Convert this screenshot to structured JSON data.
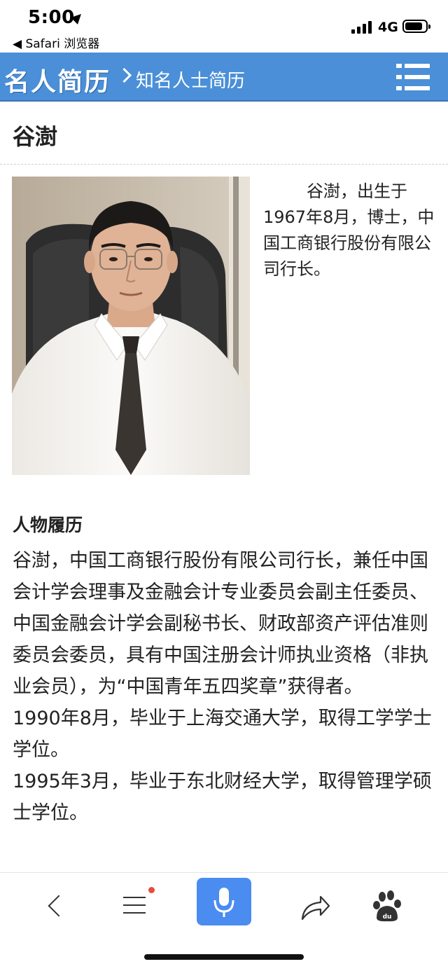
{
  "status_bar": {
    "time": "5:00",
    "back_app": "◀ Safari 浏览器",
    "network": "4G",
    "battery_level": 0.85
  },
  "header": {
    "logo": "名人简历",
    "subtitle": "知名人士简历",
    "menu_icon": "menu-list-icon",
    "color": "#4a8fd8"
  },
  "page": {
    "title": "谷澍",
    "intro": "谷澍，出生于1967年8月，博士，中国工商银行股份有限公司行长。",
    "section_title": "人物履历",
    "bio": [
      "谷澍，中国工商银行股份有限公司行长，兼任中国会计学会理事及金融会计专业委员会副主任委员、中国金融会计学会副秘书长、财政部资产评估准则委员会委员，具有中国注册会计师执业资格（非执业会员），为“中国青年五四奖章”获得者。",
      "1990年8月，毕业于上海交通大学，取得工学学士学位。",
      "1995年3月，毕业于东北财经大学，取得管理学硕士学位。"
    ]
  },
  "toolbar": {
    "back_icon": "back-chevron-icon",
    "menu_icon": "menu-icon",
    "voice_icon": "microphone-icon",
    "share_icon": "share-icon",
    "baidu_icon": "baidu-paw-icon",
    "notification_dot_color": "#e74c3c",
    "voice_button_color": "#4a8cf0"
  }
}
